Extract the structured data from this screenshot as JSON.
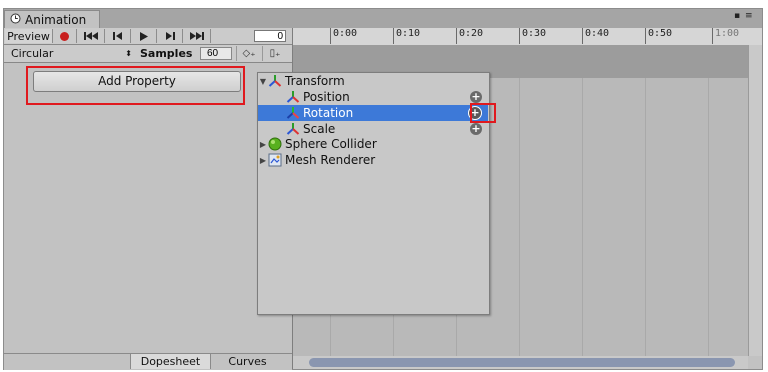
{
  "window": {
    "tab_title": "Animation",
    "window_buttons": "▪ ≡"
  },
  "toolbar": {
    "preview_label": "Preview",
    "record_icon": "record-icon",
    "frame_value": "0"
  },
  "clip": {
    "selected": "Circular",
    "samples_label": "Samples",
    "samples_value": "60"
  },
  "left_pane": {
    "add_property_label": "Add Property"
  },
  "bottom_tabs": {
    "dopesheet": "Dopesheet",
    "curves": "Curves"
  },
  "timeline": {
    "ticks": [
      "0:00",
      "0:10",
      "0:20",
      "0:30",
      "0:40",
      "0:50",
      "1:00"
    ]
  },
  "property_popup": {
    "items": [
      {
        "label": "Transform",
        "icon": "transform-axes-icon"
      },
      {
        "label": "Position",
        "icon": "transform-axes-icon"
      },
      {
        "label": "Rotation",
        "icon": "transform-axes-icon"
      },
      {
        "label": "Scale",
        "icon": "transform-axes-icon"
      },
      {
        "label": "Sphere Collider",
        "icon": "sphere-collider-icon"
      },
      {
        "label": "Mesh Renderer",
        "icon": "mesh-renderer-icon"
      }
    ]
  },
  "colors": {
    "selection": "#3d79d8",
    "highlight_box": "#e0191e",
    "record": "#c8201f"
  }
}
